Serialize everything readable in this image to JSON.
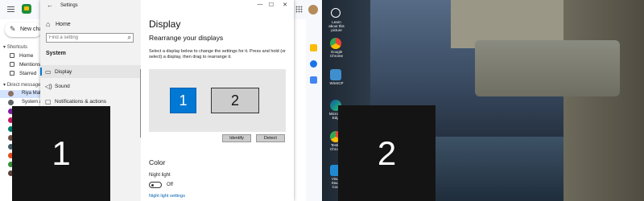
{
  "chat": {
    "new_chat": "New chat",
    "shortcuts_header": "Shortcuts",
    "shortcuts": [
      "Home",
      "Mentions",
      "Starred"
    ],
    "dm_header": "Direct messages",
    "dms": [
      "Riya Mall",
      "System a"
    ]
  },
  "settings": {
    "window_title": "Settings",
    "home": "Home",
    "search_placeholder": "Find a setting",
    "section": "System",
    "nav": [
      "Display",
      "Sound",
      "Notifications & actions"
    ],
    "page_title": "Display",
    "rearrange_title": "Rearrange your displays",
    "rearrange_text": "Select a display below to change the settings for it. Press and hold (or select) a display, then drag to rearrange it.",
    "monitor1": "1",
    "monitor2": "2",
    "identify": "Identify",
    "detect": "Detect",
    "color_title": "Color",
    "night_light": "Night light",
    "toggle_state": "Off",
    "night_link": "Night light settings"
  },
  "overlays": {
    "screen1": "1",
    "screen2": "2"
  },
  "desktop_icons": [
    "Learn about this picture",
    "Google Chrome",
    "WinSCP",
    "Microsoft Edge",
    "Testing Chrome",
    "Visual Studio Code"
  ],
  "colors": {
    "accent": "#0078d4",
    "chat_green": "#1e8e3e"
  }
}
